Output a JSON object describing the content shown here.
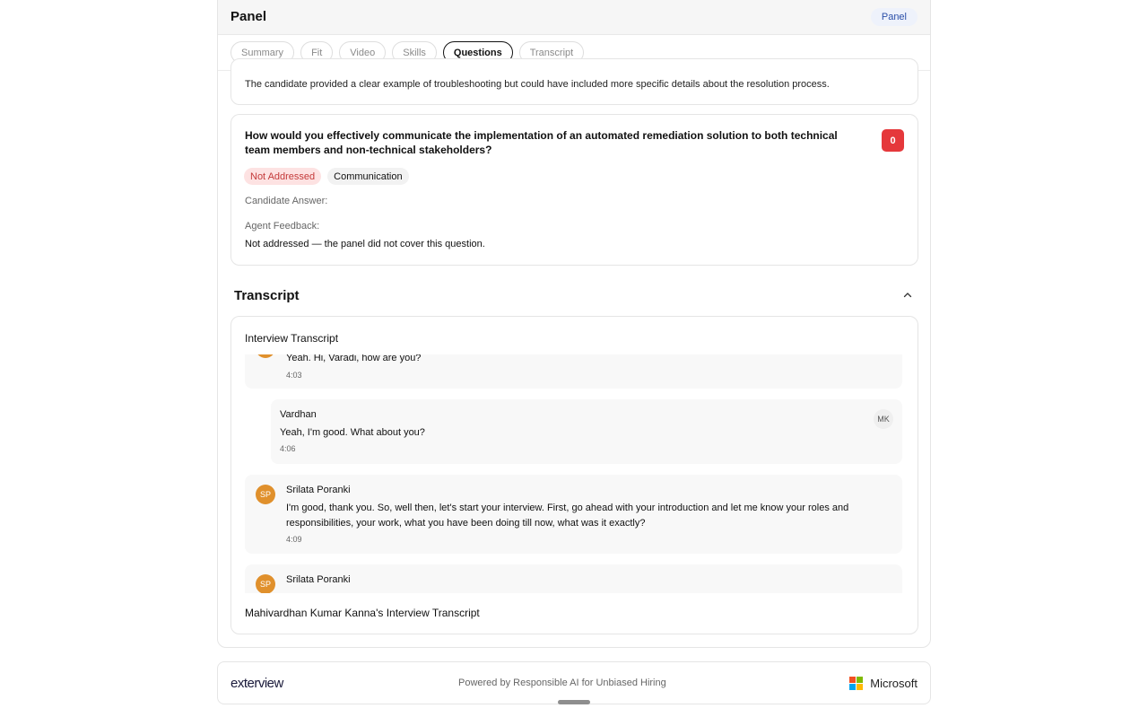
{
  "panel": {
    "title": "Panel",
    "badge": "Panel"
  },
  "tabs": [
    {
      "label": "Summary"
    },
    {
      "label": "Fit"
    },
    {
      "label": "Video"
    },
    {
      "label": "Skills"
    },
    {
      "label": "Questions",
      "active": true
    },
    {
      "label": "Transcript"
    }
  ],
  "previous_question": {
    "feedback": "The candidate provided a clear example of troubleshooting but could have included more specific details about the resolution process."
  },
  "question": {
    "title": "How would you effectively communicate the implementation of an automated remediation solution to both technical team members and non-technical stakeholders?",
    "score": "0",
    "status_chip": "Not Addressed",
    "skill_chip": "Communication",
    "answer_label": "Candidate Answer:",
    "answer_value": "",
    "feedback_label": "Agent Feedback:",
    "feedback_value": "Not addressed — the panel did not cover this question."
  },
  "transcript": {
    "section_title": "Transcript",
    "card_title": "Interview Transcript",
    "messages": [
      {
        "speaker": "",
        "text": "Yeah. Hi, Varadi, how are you?",
        "time": "4:03"
      },
      {
        "speaker": "Vardhan",
        "avatar": "MK",
        "text": "Yeah, I'm good. What about you?",
        "time": "4:06"
      },
      {
        "speaker": "Srilata Poranki",
        "avatar": "SP",
        "text": "I'm good, thank you. So, well then, let's start your interview. First, go ahead with your introduction and let me know your roles and responsibilities, your work, what you have been doing till now, what was it exactly?",
        "time": "4:09"
      },
      {
        "speaker": "Srilata Poranki",
        "avatar": "SP",
        "text": "",
        "time": ""
      }
    ],
    "footer_title": "Mahivardhan Kumar Kanna's Interview Transcript"
  },
  "footer": {
    "brand": "exterview",
    "powered_by": "Powered by Responsible AI for Unbiased Hiring",
    "partner": "Microsoft"
  },
  "colors": {
    "score_red": "#e5383b",
    "status_red_bg": "#fde2e2",
    "avatar_orange": "#e0902c",
    "badge_blue": "#2b4fa8"
  }
}
